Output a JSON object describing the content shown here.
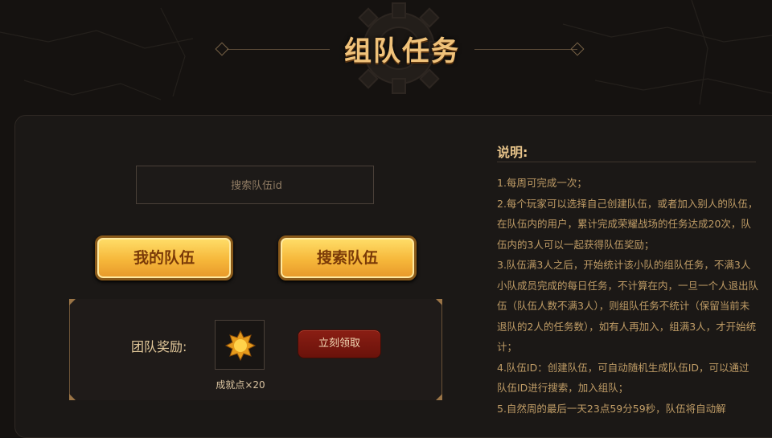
{
  "header": {
    "title": "组队任务"
  },
  "search": {
    "placeholder": "搜索队伍id"
  },
  "buttons": {
    "my_team": "我的队伍",
    "search_team": "搜索队伍",
    "claim": "立刻领取"
  },
  "reward": {
    "label": "团队奖励:",
    "item_icon": "sun-badge-icon",
    "item_caption": "成就点×20"
  },
  "description": {
    "title": "说明:",
    "paragraphs": [
      "1.每周可完成一次；",
      "2.每个玩家可以选择自己创建队伍，或者加入别人的队伍，在队伍内的用户，累计完成荣耀战场的任务达成20次，队伍内的3人可以一起获得队伍奖励；",
      "3.队伍满3人之后，开始统计该小队的组队任务，不满3人小队成员完成的每日任务，不计算在内，一旦一个人退出队伍（队伍人数不满3人），则组队任务不统计（保留当前未退队的2人的任务数），如有人再加入，组满3人，才开始统计；",
      "4.队伍ID：创建队伍，可自动随机生成队伍ID，可以通过队伍ID进行搜索，加入组队；",
      "5.自然周的最后一天23点59分59秒，队伍将自动解"
    ]
  },
  "colors": {
    "gold": "#f6b73a",
    "claim_red": "#7a160c",
    "background": "#151210"
  }
}
